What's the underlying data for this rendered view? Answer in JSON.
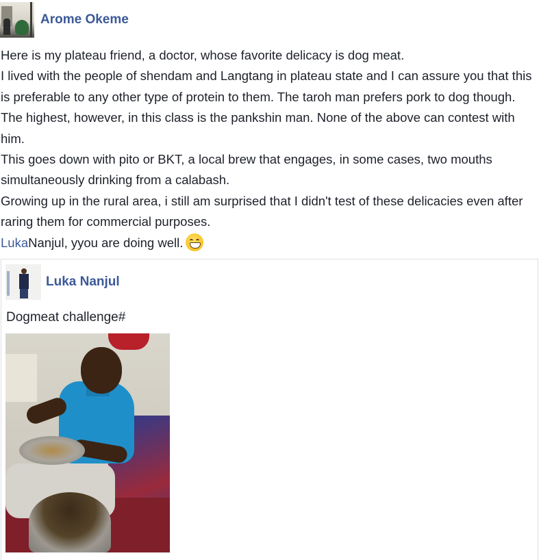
{
  "post": {
    "author": "Arome Okeme",
    "paragraphs": [
      "Here is my plateau friend, a doctor, whose favorite delicacy is dog meat.",
      "I lived with the people of shendam and Langtang in plateau state and I can assure you that this is preferable to any other type of protein to them. The taroh man prefers pork to dog though. The highest, however, in this class is the pankshin man. None of the above can contest with him.",
      "This goes down with pito or BKT, a local brew that engages, in some cases, two mouths simultaneously drinking from a calabash.",
      "Growing up in the rural area, i still am surprised that I didn't test of these delicacies even after raring them for commercial purposes."
    ],
    "mention_link": "Luka",
    "mention_rest": "Nanjul, yyou are doing well.",
    "emoji": "grinning-face-emoji"
  },
  "shared_post": {
    "author": "Luka Nanjul",
    "text": "Dogmeat challenge#"
  },
  "colors": {
    "link": "#3b5998",
    "text": "#1d2129",
    "border": "#dddfe2"
  }
}
